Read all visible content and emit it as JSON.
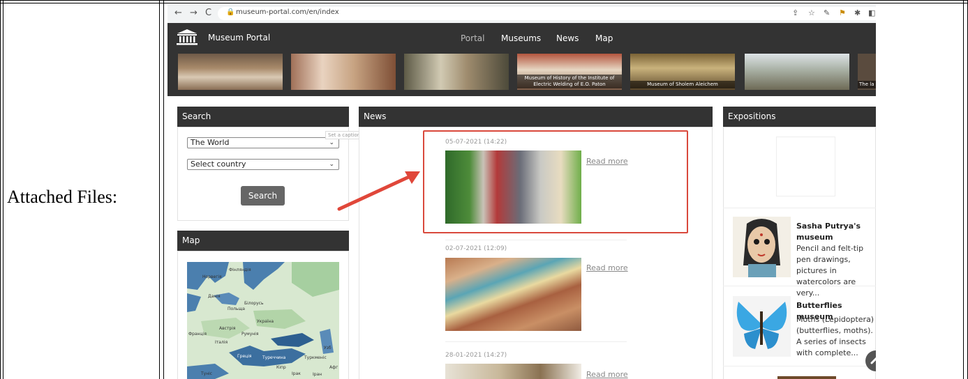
{
  "outer": {
    "label": "Attached Files:"
  },
  "browser": {
    "url": "museum-portal.com/en/index",
    "back": "←",
    "forward": "→",
    "reload": "C",
    "lock": "🔒",
    "icons": [
      "share-icon",
      "star-icon",
      "extension-icon",
      "flag-icon",
      "puzzle-icon",
      "sidebar-icon"
    ]
  },
  "header": {
    "brand": "Museum Portal",
    "nav": [
      "Portal",
      "Museums",
      "News",
      "Map"
    ],
    "active_nav": "Portal",
    "slides": [
      "",
      "",
      "",
      "Museum of History of the Institute of Electric Welding of E.O. Paton",
      "Museum of Sholem Aleichem",
      "",
      "The la"
    ]
  },
  "search": {
    "title": "Search",
    "world_value": "The World",
    "country_value": "Select country",
    "button": "Search",
    "tooltip": "Set a caption"
  },
  "map": {
    "title": "Map",
    "labels": [
      "Фінляндія",
      "Норвегія",
      "Данія",
      "Білорусь",
      "Польща",
      "Україна",
      "Австрія",
      "Франція",
      "Румунія",
      "Італія",
      "Греція",
      "Туреччина",
      "Узб",
      "Туркменіс",
      "Кіпр",
      "Ірак",
      "Туніс",
      "Афг",
      "Іран"
    ]
  },
  "news": {
    "title": "News",
    "items": [
      {
        "date": "05-07-2021 (14:22)",
        "link": "Read more"
      },
      {
        "date": "02-07-2021 (12:09)",
        "link": "Read more"
      },
      {
        "date": "28-01-2021 (14:27)",
        "link": "Read more"
      }
    ]
  },
  "expositions": {
    "title": "Expositions",
    "items": [
      {
        "title": "Sasha Putrya's museum",
        "desc": "Pencil and felt-tip pen drawings, pictures in watercolors are very..."
      },
      {
        "title": "Butterflies museum",
        "desc": "Moths (Lepidoptera) (butterflies, moths). A series of insects with complete..."
      }
    ]
  },
  "colors": {
    "header_bg": "#333333",
    "highlight": "#d9493c",
    "arrow": "#e0473a"
  }
}
